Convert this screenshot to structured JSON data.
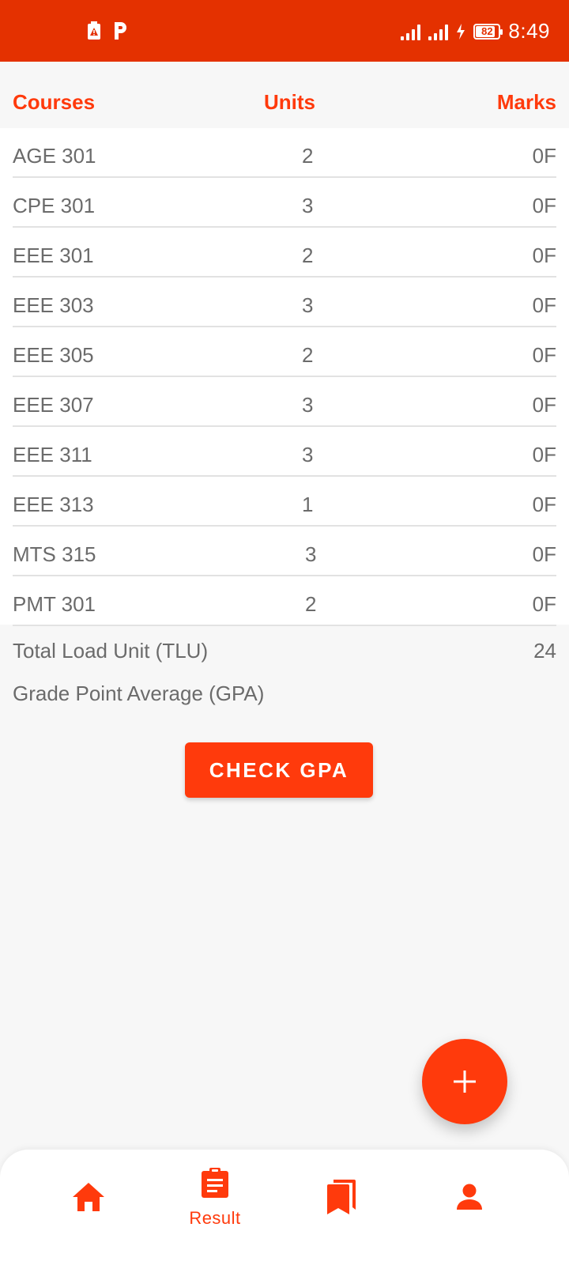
{
  "status_bar": {
    "time": "8:49",
    "battery": "82"
  },
  "table": {
    "headers": {
      "courses": "Courses",
      "units": "Units",
      "marks": "Marks"
    },
    "rows": [
      {
        "course": "AGE 301",
        "unit": "2",
        "mark": "0F"
      },
      {
        "course": "CPE 301",
        "unit": "3",
        "mark": "0F"
      },
      {
        "course": "EEE 301",
        "unit": "2",
        "mark": "0F"
      },
      {
        "course": "EEE 303",
        "unit": "3",
        "mark": "0F"
      },
      {
        "course": "EEE 305",
        "unit": "2",
        "mark": "0F"
      },
      {
        "course": "EEE 307",
        "unit": "3",
        "mark": "0F"
      },
      {
        "course": "EEE 311",
        "unit": "3",
        "mark": "0F"
      },
      {
        "course": "EEE 313",
        "unit": "1",
        "mark": "0F"
      },
      {
        "course": "MTS 315",
        "unit": "3",
        "mark": "0F"
      },
      {
        "course": "PMT 301",
        "unit": "2",
        "mark": "0F"
      }
    ]
  },
  "totals": {
    "tlu_label": "Total Load Unit (TLU)",
    "tlu_value": "24",
    "gpa_label": "Grade Point Average (GPA)",
    "gpa_value": ""
  },
  "check_button_label": "CHECK GPA",
  "fab": {
    "icon": "plus-icon"
  },
  "bottom_nav": {
    "items": [
      {
        "icon": "home-icon",
        "label": ""
      },
      {
        "icon": "clipboard-icon",
        "label": "Result"
      },
      {
        "icon": "bookmarks-icon",
        "label": ""
      },
      {
        "icon": "person-icon",
        "label": ""
      }
    ]
  },
  "colors": {
    "status_bar": "#e43100",
    "accent": "#ff3a0c",
    "text": "#6b6b6b",
    "background": "#f7f7f7"
  }
}
